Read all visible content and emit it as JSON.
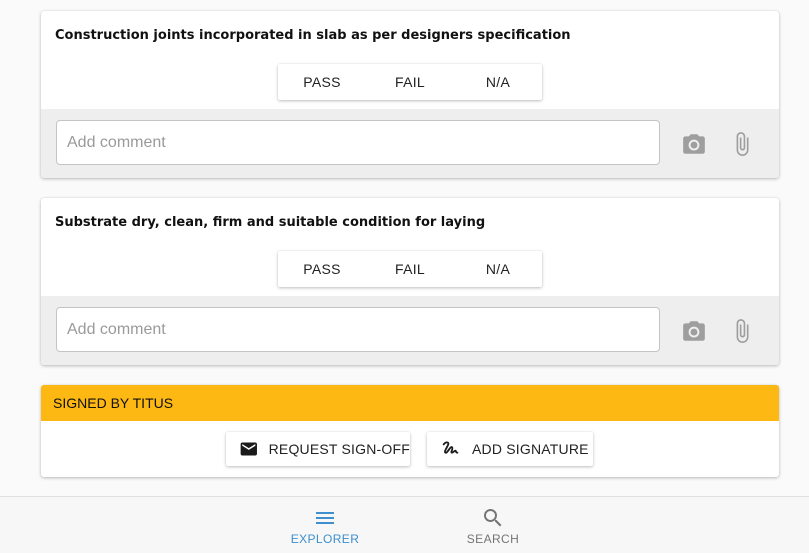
{
  "checklist_items": [
    {
      "title": "Construction joints incorporated in slab as per designers specification",
      "options": [
        "PASS",
        "FAIL",
        "N/A"
      ],
      "comment_placeholder": "Add comment",
      "camera_icon": "camera-icon",
      "attach_icon": "paperclip-icon"
    },
    {
      "title": "Substrate dry, clean, firm and suitable condition for laying",
      "options": [
        "PASS",
        "FAIL",
        "N/A"
      ],
      "comment_placeholder": "Add comment",
      "camera_icon": "camera-icon",
      "attach_icon": "paperclip-icon"
    }
  ],
  "signoff": {
    "header": "SIGNED BY TITUS",
    "header_color": "#fdb813",
    "request_label": "REQUEST SIGN-OFF",
    "request_icon": "envelope-icon",
    "signature_label": "ADD SIGNATURE",
    "signature_icon": "signature-icon"
  },
  "bottom_nav": {
    "items": [
      {
        "label": "EXPLORER",
        "icon": "menu-icon",
        "active": true
      },
      {
        "label": "SEARCH",
        "icon": "search-icon",
        "active": false
      }
    ],
    "active_color": "#3d8fce",
    "inactive_color": "#757575"
  }
}
